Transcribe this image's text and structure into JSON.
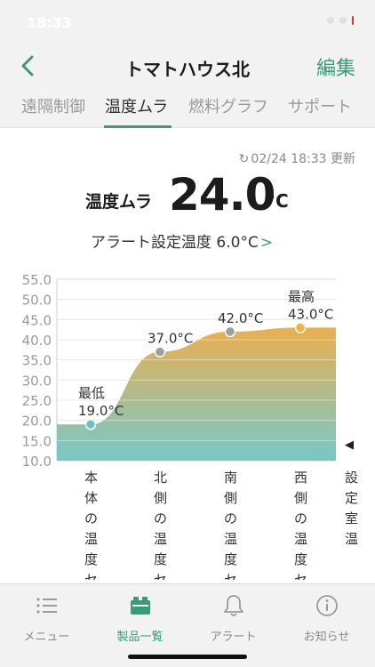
{
  "status": {
    "time": "18:33"
  },
  "nav": {
    "title": "トマトハウス北",
    "edit_label": "編集",
    "back_icon": "chevron-left-icon"
  },
  "tabs": [
    {
      "label": "遠隔制御",
      "active": false
    },
    {
      "label": "温度ムラ",
      "active": true
    },
    {
      "label": "燃料グラフ",
      "active": false
    },
    {
      "label": "サポート",
      "active": false
    }
  ],
  "updated": {
    "text": "02/24 18:33 更新",
    "icon": "refresh-icon"
  },
  "temperature": {
    "label": "温度ムラ",
    "value": "24.0",
    "unit": "°C"
  },
  "alert": {
    "text": "アラート設定温度 6.0°C",
    "chevron": ">"
  },
  "chart_data": {
    "type": "area",
    "categories": [
      "本体の温度セ",
      "北側の温度セ",
      "南側の温度セ",
      "西側の温度セ"
    ],
    "values": [
      19.0,
      37.0,
      42.0,
      43.0
    ],
    "point_labels": [
      "19.0°C",
      "37.0°C",
      "42.0°C",
      "43.0°C"
    ],
    "annotations": [
      {
        "category": "本体の温度セ",
        "text": "最低"
      },
      {
        "category": "西側の温度セ",
        "text": "最高"
      }
    ],
    "y_ticks": [
      "55.0",
      "50.0",
      "45.0",
      "40.0",
      "35.0",
      "30.0",
      "25.0",
      "20.0",
      "15.0",
      "10.0"
    ],
    "ylim": [
      10,
      55
    ],
    "set_temp": {
      "label": "設定室温",
      "marker": "◀"
    },
    "grid": true,
    "colors": {
      "top": "#e8a840",
      "bottom": "#6cc3c3",
      "point_fill": "#9e9e9e",
      "max_point_fill": "#f5b040",
      "min_point_fill": "#6cc3c3"
    }
  },
  "tabbar": [
    {
      "label": "メニュー",
      "icon": "menu-icon",
      "active": false
    },
    {
      "label": "製品一覧",
      "icon": "product-list-icon",
      "active": true
    },
    {
      "label": "アラート",
      "icon": "bell-icon",
      "active": false
    },
    {
      "label": "お知らせ",
      "icon": "info-icon",
      "active": false
    }
  ]
}
